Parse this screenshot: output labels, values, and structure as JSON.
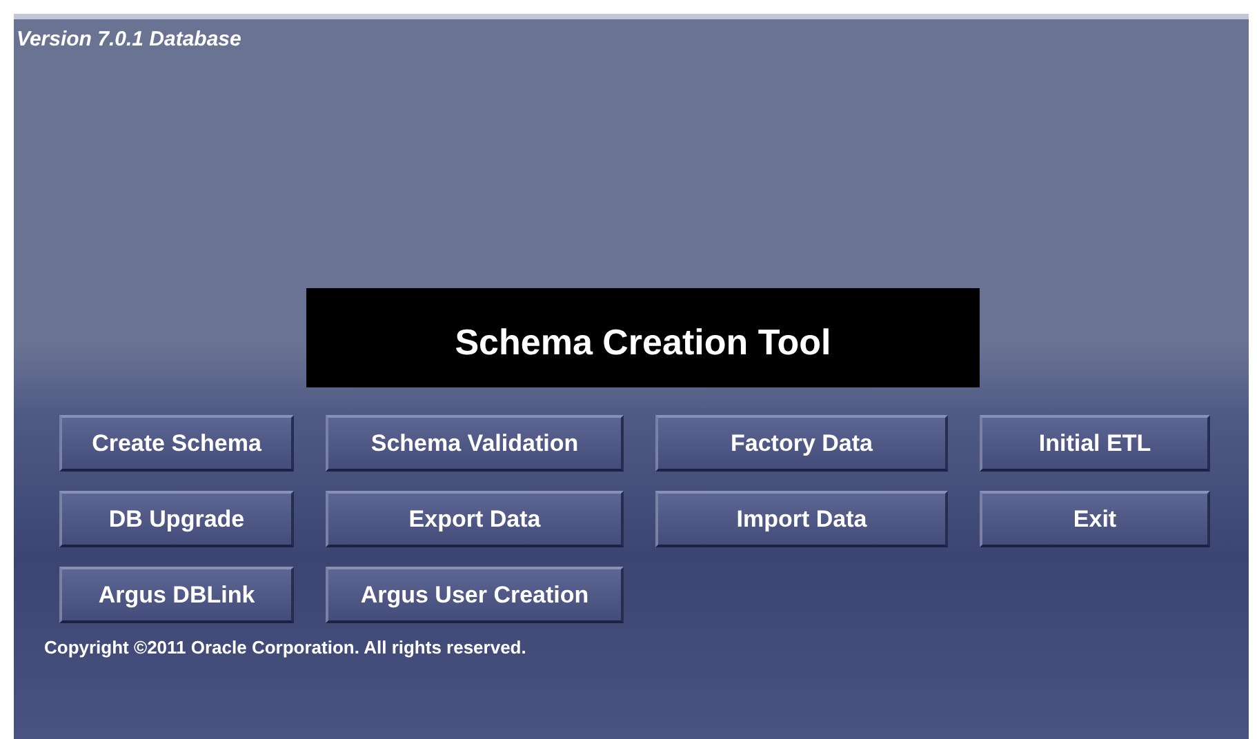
{
  "version_label": "Version 7.0.1 Database",
  "title": "Schema Creation Tool",
  "button_rows": [
    [
      "Create Schema",
      "Schema Validation",
      "Factory Data",
      "Initial ETL"
    ],
    [
      "DB Upgrade",
      "Export Data",
      "Import Data",
      "Exit"
    ],
    [
      "Argus DBLink",
      "Argus User Creation"
    ]
  ],
  "copyright": "Copyright ©2011 Oracle Corporation. All rights reserved."
}
